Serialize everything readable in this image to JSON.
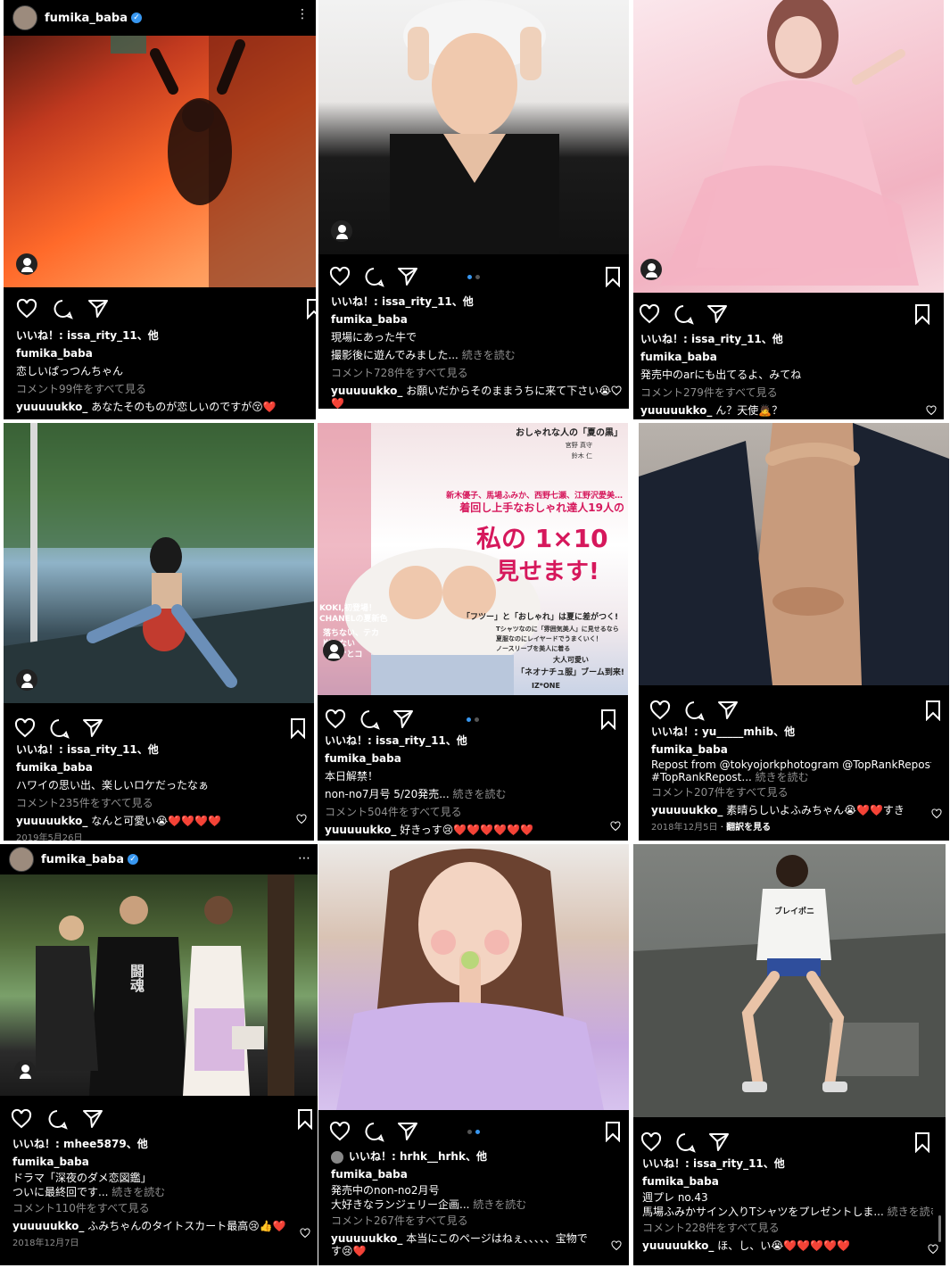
{
  "posts": [
    {
      "header": {
        "username": "fumika_baba",
        "more": "⋮"
      },
      "likes": "いいね！: issa_rity_11、他",
      "author": "fumika_baba",
      "caption": [
        "恋しいぱっつんちゃん"
      ],
      "more_label": "",
      "comments_link": "コメント99件をすべて見る",
      "comment_user": "yuuuuukko_",
      "comment_text": "あなたそのものが恋しいのですが😚❤️",
      "date": ""
    },
    {
      "likes": "いいね！: issa_rity_11、他",
      "author": "fumika_baba",
      "caption": [
        "現場にあった牛で",
        "撮影後に遊んでみました..."
      ],
      "more_label": "続きを読む",
      "comments_link": "コメント728件をすべて見る",
      "comment_user": "yuuuuukko_",
      "comment_text": "お願いだからそのままうちに来て下さい😭",
      "comment_text2": "❤️",
      "date": ""
    },
    {
      "likes": "いいね！: issa_rity_11、他",
      "author": "fumika_baba",
      "caption": [
        "発売中のarにも出てるよ、みてね"
      ],
      "more_label": "",
      "comments_link": "コメント279件をすべて見る",
      "comment_user": "yuuuuukko_",
      "comment_text": "ん？天使🙇？",
      "date": ""
    },
    {
      "likes": "いいね！: issa_rity_11、他",
      "author": "fumika_baba",
      "caption": [
        "ハワイの思い出、楽しいロケだったなぁ"
      ],
      "more_label": "",
      "comments_link": "コメント235件をすべて見る",
      "comment_user": "yuuuuukko_",
      "comment_text": "なんと可愛い😭❤️❤️❤️❤️",
      "date": "2019年5月26日"
    },
    {
      "likes": "いいね！: issa_rity_11、他",
      "author": "fumika_baba",
      "caption": [
        "本日解禁！",
        "non-no7月号 5/20発売..."
      ],
      "more_label": "続きを読む",
      "comments_link": "コメント504件をすべて見る",
      "comment_user": "yuuuuukko_",
      "comment_text": "好きっす😢❤️❤️❤️❤️❤️❤️",
      "date": "",
      "magazine": {
        "top_right": "おしゃれな人の「夏の黒」",
        "names_top": "宮野 真守",
        "names_bottom": "鈴木 仁",
        "headline_small": "新木優子、馬場ふみか、西野七瀬、江野沢愛美…",
        "headline": "着回し上手なおしゃれ達人19人の",
        "big1": "私の 1×10",
        "big2": "見せます!",
        "tag": "「フツー」と「おしゃれ」は夏に差がつく!",
        "bullets": [
          "Tシャツなのに「雰囲気美人」に見せるなら",
          "夏服なのにレイヤードでうまくいく！",
          "ノースリーブを美人に着る"
        ],
        "left1": "KOKI,初登場！",
        "left2": "CHANELの夏新色",
        "left3": "落ちない、テカ",
        "left4": "崩れない",
        "left5": "\"技\"とコ",
        "bottom_right1": "大人可愛い",
        "bottom_right2": "「ネオナチュ服」ブーム到来!",
        "brand": "IZ*ONE"
      }
    },
    {
      "likes": "いいね！: yu_____mhib、他",
      "author": "fumika_baba",
      "caption": [
        "Repost from @tokyojorkphotogram @TopRankRepost",
        "#TopRankRepost..."
      ],
      "more_label": "続きを読む",
      "comments_link": "コメント207件をすべて見る",
      "comment_user": "yuuuuukko_",
      "comment_text": "素晴らしいよふみちゃん😭❤️❤️すき",
      "date": "2018年12月5日",
      "translate": "翻訳を見る"
    },
    {
      "header": {
        "username": "fumika_baba",
        "more": "⋯"
      },
      "likes": "いいね！: mhee5879、他",
      "author": "fumika_baba",
      "caption": [
        "ドラマ「深夜のダメ恋図鑑」",
        "ついに最終回です..."
      ],
      "more_label": "続きを読む",
      "comments_link": "コメント110件をすべて見る",
      "comment_user": "yuuuuukko_",
      "comment_text": "ふみちゃんのタイトスカート最高😢👍❤️",
      "date": "2018年12月7日",
      "jacket_text": "闘魂"
    },
    {
      "likes": "いいね！: hrhk__hrhk、他",
      "author": "fumika_baba",
      "caption": [
        "発売中のnon-no2月号",
        "大好きなランジェリー企画..."
      ],
      "more_label": "続きを読む",
      "comments_link": "コメント267件をすべて見る",
      "comment_user": "yuuuuukko_",
      "comment_text": "本当にこのページはねぇ、、、、、宝物で",
      "comment_text2": "す😢❤️",
      "date": ""
    },
    {
      "likes": "いいね！: issa_rity_11、他",
      "author": "fumika_baba",
      "caption": [
        "週プレ no.43",
        "馬場ふみかサイン入りTシャツをプレゼントしま..."
      ],
      "more_label": "続きを読む",
      "comments_link": "コメント228件をすべて見る",
      "comment_user": "yuuuuukko_",
      "comment_text": "ほ、し、い😭❤️❤️❤️❤️❤️",
      "date": "",
      "shirt_text": "ブレイポニ"
    }
  ]
}
